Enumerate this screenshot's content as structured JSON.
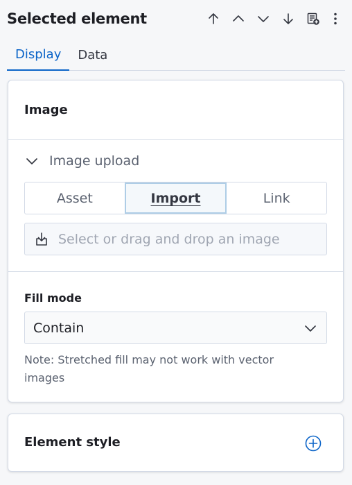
{
  "header": {
    "title": "Selected element",
    "icons": [
      "arrow-up-icon",
      "chevron-up-icon",
      "chevron-down-icon",
      "arrow-down-icon",
      "add-panel-icon",
      "kebab-menu-icon"
    ]
  },
  "tabs": [
    {
      "label": "Display",
      "active": true
    },
    {
      "label": "Data",
      "active": false
    }
  ],
  "image_panel": {
    "title": "Image",
    "accordion_label": "Image upload",
    "source_options": [
      "Asset",
      "Import",
      "Link"
    ],
    "selected_source": "Import",
    "dropzone_placeholder": "Select or drag and drop an image",
    "fill_mode_label": "Fill mode",
    "fill_mode_value": "Contain",
    "note": "Note: Stretched fill may not work with vector images"
  },
  "style_panel": {
    "title": "Element style"
  },
  "colors": {
    "accent": "#0b64c8",
    "border": "#d3dae6",
    "background": "#f6f7f9"
  }
}
